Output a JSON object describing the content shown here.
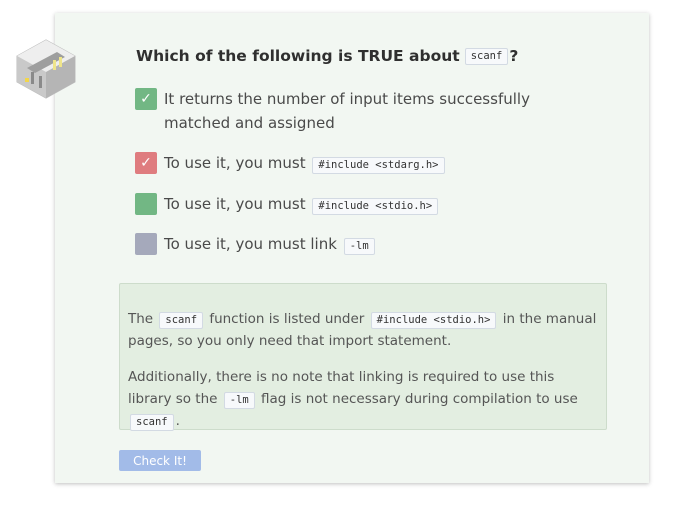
{
  "question": {
    "prefix": "Which of the following is TRUE about",
    "code": "scanf",
    "suffix": "?"
  },
  "options": [
    {
      "text": "It returns the number of input items successfully matched and assigned",
      "code": "",
      "state": "correct-checked",
      "box_color": "#72b784"
    },
    {
      "text": "To use it, you must",
      "code": "#include <stdarg.h>",
      "state": "incorrect-checked",
      "box_color": "#df7c7f"
    },
    {
      "text": "To use it, you must",
      "code": "#include <stdio.h>",
      "state": "correct-unchecked",
      "box_color": "#72b784"
    },
    {
      "text": "To use it, you must link",
      "code": "-lm",
      "state": "unchecked",
      "box_color": "#a5a9bb"
    }
  ],
  "feedback": {
    "p1": {
      "t1": "The",
      "c1": "scanf",
      "t2": "function is listed under",
      "c2": "#include <stdio.h>",
      "t3": "in the manual pages, so you only need that import statement."
    },
    "p2": {
      "t1": "Additionally, there is no note that linking is required to use this library so the",
      "c1": "-lm",
      "t2": "flag is not necessary during compilation to use",
      "c2": "scanf",
      "t3": "."
    }
  },
  "check_button": {
    "label": "Check It!"
  },
  "colors": {
    "card_bg": "#f2f7f2",
    "feedback_bg": "#e3eee1",
    "button_bg": "#a2bbe8"
  }
}
